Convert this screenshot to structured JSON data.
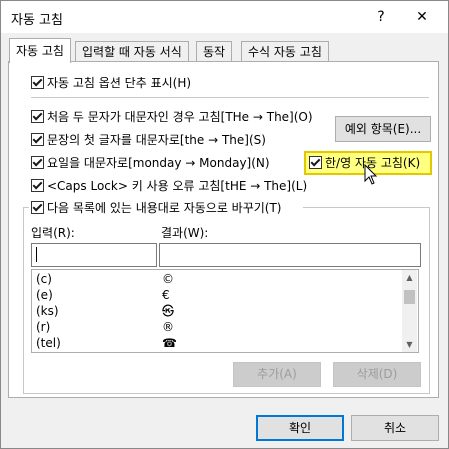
{
  "window": {
    "title": "자동 고침",
    "help": "?",
    "close": "✕"
  },
  "tabs": [
    {
      "label": "자동 고침"
    },
    {
      "label": "입력할 때 자동 서식"
    },
    {
      "label": "동작"
    },
    {
      "label": "수식 자동 고침"
    }
  ],
  "options": {
    "show_buttons": "자동 고침 옵션 단추 표시(H)",
    "two_initials": "처음 두 문자가 대문자인 경우 고침[THe → The](O)",
    "capitalize_sentences": "문장의 첫 글자를 대문자로[the → The](S)",
    "capitalize_days": "요일을 대문자로[monday → Monday](N)",
    "korean_english": "한/영 자동 고침(K)",
    "caps_lock": "<Caps Lock> 키 사용 오류 고침[tHE → The](L)",
    "replace_text": "다음 목록에 있는 내용대로 자동으로 바꾸기(T)"
  },
  "buttons": {
    "exceptions": "예외 항목(E)...",
    "add": "추가(A)",
    "delete": "삭제(D)",
    "ok": "확인",
    "cancel": "취소"
  },
  "fields": {
    "replace_label": "입력(R):",
    "with_label": "결과(W):",
    "replace_value": "",
    "with_value": ""
  },
  "list": [
    {
      "input": "(c)",
      "result": "©"
    },
    {
      "input": "(e)",
      "result": "€"
    },
    {
      "input": "(ks)",
      "result": "㉿"
    },
    {
      "input": "(r)",
      "result": "®"
    },
    {
      "input": "(tel)",
      "result": "☎"
    }
  ],
  "colors": {
    "highlight_fill": "#ffff80",
    "highlight_border": "#e3c800",
    "focus_border": "#0078d7"
  }
}
